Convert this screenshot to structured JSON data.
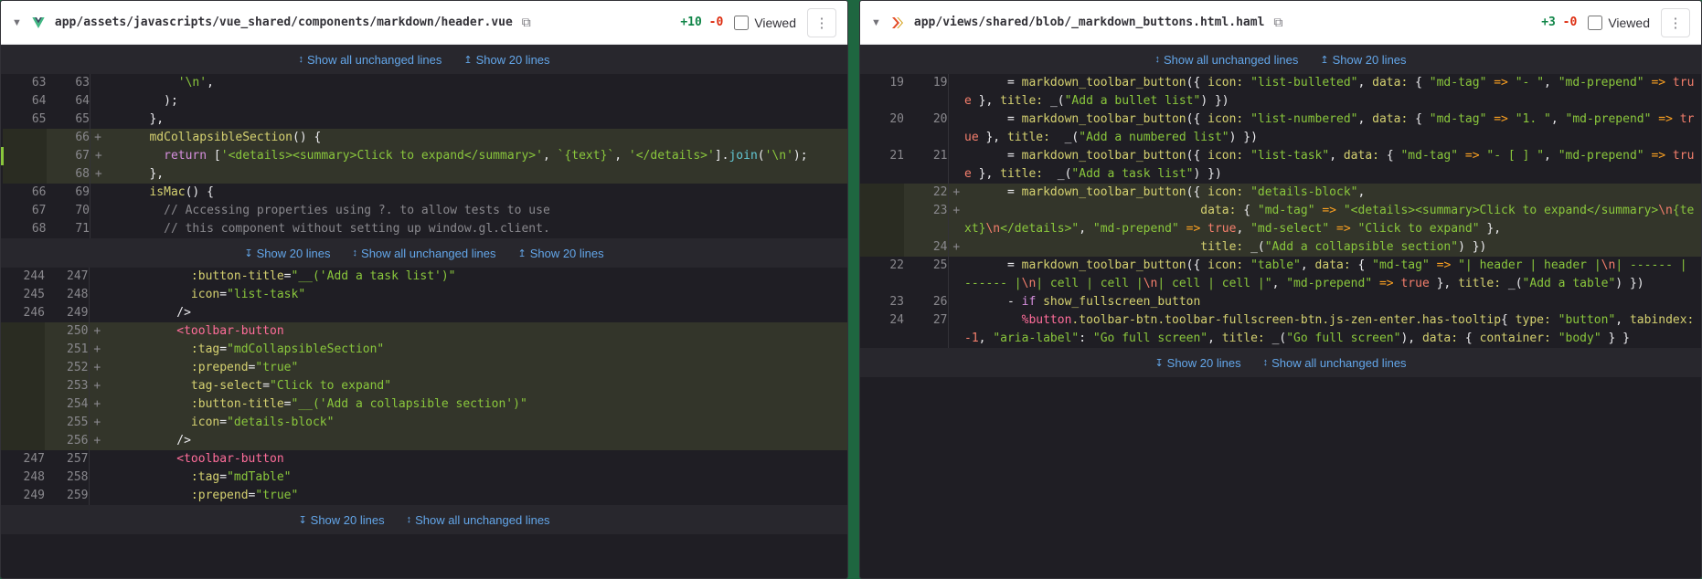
{
  "panels": [
    {
      "icon": "vue",
      "path": "app/assets/javascripts/vue_shared/components/markdown/header.vue",
      "added": "+10",
      "removed": "-0",
      "viewed_label": "Viewed",
      "expand_top": [
        "Show all unchanged lines",
        "Show 20 lines"
      ],
      "rows1": [
        {
          "o": "63",
          "n": "63",
          "t": "ctx",
          "sign": "",
          "html": "          <span class='c-str'>'\\n'</span><span class='c-punc'>,</span>"
        },
        {
          "o": "64",
          "n": "64",
          "t": "ctx",
          "sign": "",
          "html": "        <span class='c-punc'>);</span>"
        },
        {
          "o": "65",
          "n": "65",
          "t": "ctx",
          "sign": "",
          "html": "      <span class='c-punc'>},</span>"
        },
        {
          "o": "",
          "n": "66",
          "t": "added",
          "sign": "+",
          "html": "      <span class='c-attr'>mdCollapsibleSection</span><span class='c-punc'>()</span> <span class='c-punc'>{</span>"
        },
        {
          "o": "",
          "n": "67",
          "t": "added-hl",
          "sign": "+",
          "html": "        <span class='c-kw'>return</span> <span class='c-punc'>[</span><span class='c-str'>'&lt;details&gt;&lt;summary&gt;Click to expand&lt;/summary&gt;'</span><span class='c-punc'>,</span> <span class='c-str'>`{text}`</span><span class='c-punc'>,</span> <span class='c-str'>'&lt;/details&gt;'</span><span class='c-punc'>].</span><span class='c-func'>join</span><span class='c-punc'>(</span><span class='c-str'>'\\n'</span><span class='c-punc'>);</span>"
        },
        {
          "o": "",
          "n": "68",
          "t": "added",
          "sign": "+",
          "html": "      <span class='c-punc'>},</span>"
        },
        {
          "o": "66",
          "n": "69",
          "t": "ctx",
          "sign": "",
          "html": "      <span class='c-attr'>isMac</span><span class='c-punc'>()</span> <span class='c-punc'>{</span>"
        },
        {
          "o": "67",
          "n": "70",
          "t": "ctx",
          "sign": "",
          "html": "        <span class='c-comment'>// Accessing properties using ?. to allow tests to use</span>"
        },
        {
          "o": "68",
          "n": "71",
          "t": "ctx",
          "sign": "",
          "html": "        <span class='c-comment'>// this component without setting up window.gl.client.</span>"
        }
      ],
      "expand_mid": [
        "Show 20 lines",
        "Show all unchanged lines",
        "Show 20 lines"
      ],
      "rows2": [
        {
          "o": "244",
          "n": "247",
          "t": "ctx",
          "sign": "",
          "html": "            <span class='c-attr'>:button-title</span>=<span class='c-str'>\"__('Add a task list')\"</span>"
        },
        {
          "o": "245",
          "n": "248",
          "t": "ctx",
          "sign": "",
          "html": "            <span class='c-attr'>icon</span>=<span class='c-str'>\"list-task\"</span>"
        },
        {
          "o": "246",
          "n": "249",
          "t": "ctx",
          "sign": "",
          "html": "          <span class='c-punc'>/&gt;</span>"
        },
        {
          "o": "",
          "n": "250",
          "t": "added",
          "sign": "+",
          "html": "          <span class='c-tag'>&lt;toolbar-button</span>"
        },
        {
          "o": "",
          "n": "251",
          "t": "added",
          "sign": "+",
          "html": "            <span class='c-attr'>:tag</span>=<span class='c-str'>\"mdCollapsibleSection\"</span>"
        },
        {
          "o": "",
          "n": "252",
          "t": "added",
          "sign": "+",
          "html": "            <span class='c-attr'>:prepend</span>=<span class='c-str'>\"true\"</span>"
        },
        {
          "o": "",
          "n": "253",
          "t": "added",
          "sign": "+",
          "html": "            <span class='c-attr'>tag-select</span>=<span class='c-str'>\"Click to expand\"</span>"
        },
        {
          "o": "",
          "n": "254",
          "t": "added",
          "sign": "+",
          "html": "            <span class='c-attr'>:button-title</span>=<span class='c-str'>\"__('Add a collapsible section')\"</span>"
        },
        {
          "o": "",
          "n": "255",
          "t": "added",
          "sign": "+",
          "html": "            <span class='c-attr'>icon</span>=<span class='c-str'>\"details-block\"</span>"
        },
        {
          "o": "",
          "n": "256",
          "t": "added",
          "sign": "+",
          "html": "          <span class='c-punc'>/&gt;</span>"
        },
        {
          "o": "247",
          "n": "257",
          "t": "ctx",
          "sign": "",
          "html": "          <span class='c-tag'>&lt;toolbar-button</span>"
        },
        {
          "o": "248",
          "n": "258",
          "t": "ctx",
          "sign": "",
          "html": "            <span class='c-attr'>:tag</span>=<span class='c-str'>\"mdTable\"</span>"
        },
        {
          "o": "249",
          "n": "259",
          "t": "ctx",
          "sign": "",
          "html": "            <span class='c-attr'>:prepend</span>=<span class='c-str'>\"true\"</span>"
        }
      ],
      "expand_bot": [
        "Show 20 lines",
        "Show all unchanged lines"
      ]
    },
    {
      "icon": "haml",
      "path": "app/views/shared/blob/_markdown_buttons.html.haml",
      "added": "+3",
      "removed": "-0",
      "viewed_label": "Viewed",
      "expand_top": [
        "Show all unchanged lines",
        "Show 20 lines"
      ],
      "rows1": [
        {
          "o": "19",
          "n": "19",
          "t": "ctx",
          "sign": "",
          "html": "      <span class='c-punc'>=</span> <span class='c-key'>markdown_toolbar_button</span><span class='c-punc'>({</span> <span class='c-attr'>icon:</span> <span class='c-str'>\"list-bulleted\"</span><span class='c-punc'>,</span> <span class='c-attr'>data:</span> <span class='c-punc'>{</span> <span class='c-str'>\"md-tag\"</span> <span class='c-op'>=&gt;</span> <span class='c-str'>\"- \"</span><span class='c-punc'>,</span> <span class='c-str'>\"md-prepend\"</span> <span class='c-op'>=&gt;</span> <span class='c-bool'>true</span> <span class='c-punc'>},</span> <span class='c-attr'>title:</span> <span class='c-punc'>_(</span><span class='c-str'>\"Add a bullet list\"</span><span class='c-punc'>) })</span>"
        },
        {
          "o": "20",
          "n": "20",
          "t": "ctx",
          "sign": "",
          "html": "      <span class='c-punc'>=</span> <span class='c-key'>markdown_toolbar_button</span><span class='c-punc'>({</span> <span class='c-attr'>icon:</span> <span class='c-str'>\"list-numbered\"</span><span class='c-punc'>,</span> <span class='c-attr'>data:</span> <span class='c-punc'>{</span> <span class='c-str'>\"md-tag\"</span> <span class='c-op'>=&gt;</span> <span class='c-str'>\"1. \"</span><span class='c-punc'>,</span> <span class='c-str'>\"md-prepend\"</span> <span class='c-op'>=&gt;</span> <span class='c-bool'>true</span> <span class='c-punc'>},</span> <span class='c-attr'>title:</span>  <span class='c-punc'>_(</span><span class='c-str'>\"Add a numbered list\"</span><span class='c-punc'>) })</span>"
        },
        {
          "o": "21",
          "n": "21",
          "t": "ctx",
          "sign": "",
          "html": "      <span class='c-punc'>=</span> <span class='c-key'>markdown_toolbar_button</span><span class='c-punc'>({</span> <span class='c-attr'>icon:</span> <span class='c-str'>\"list-task\"</span><span class='c-punc'>,</span> <span class='c-attr'>data:</span> <span class='c-punc'>{</span> <span class='c-str'>\"md-tag\"</span> <span class='c-op'>=&gt;</span> <span class='c-str'>\"- [ ] \"</span><span class='c-punc'>,</span> <span class='c-str'>\"md-prepend\"</span> <span class='c-op'>=&gt;</span> <span class='c-bool'>true</span> <span class='c-punc'>},</span> <span class='c-attr'>title:</span>  <span class='c-punc'>_(</span><span class='c-str'>\"Add a task list\"</span><span class='c-punc'>) })</span>"
        },
        {
          "o": "",
          "n": "22",
          "t": "added",
          "sign": "+",
          "html": "      <span class='c-punc'>=</span> <span class='c-key'>markdown_toolbar_button</span><span class='c-punc'>({</span> <span class='c-attr'>icon:</span> <span class='c-str'>\"details-block\"</span><span class='c-punc'>,</span>"
        },
        {
          "o": "",
          "n": "23",
          "t": "added",
          "sign": "+",
          "html": "                                 <span class='c-attr'>data:</span> <span class='c-punc'>{</span> <span class='c-str'>\"md-tag\"</span> <span class='c-op'>=&gt;</span> <span class='c-str'>\"&lt;details&gt;&lt;summary&gt;Click to expand&lt;/summary&gt;</span><span class='c-bool'>\\n</span><span class='c-str'>{text}</span><span class='c-bool'>\\n</span><span class='c-str'>&lt;/details&gt;\"</span><span class='c-punc'>,</span> <span class='c-str'>\"md-prepend\"</span> <span class='c-op'>=&gt;</span> <span class='c-bool'>true</span><span class='c-punc'>,</span> <span class='c-str'>\"md-select\"</span> <span class='c-op'>=&gt;</span> <span class='c-str'>\"Click to expand\"</span> <span class='c-punc'>},</span>"
        },
        {
          "o": "",
          "n": "24",
          "t": "added",
          "sign": "+",
          "html": "                                 <span class='c-attr'>title:</span> <span class='c-punc'>_(</span><span class='c-str'>\"Add a collapsible section\"</span><span class='c-punc'>) })</span>"
        },
        {
          "o": "22",
          "n": "25",
          "t": "ctx",
          "sign": "",
          "html": "      <span class='c-punc'>=</span> <span class='c-key'>markdown_toolbar_button</span><span class='c-punc'>({</span> <span class='c-attr'>icon:</span> <span class='c-str'>\"table\"</span><span class='c-punc'>,</span> <span class='c-attr'>data:</span> <span class='c-punc'>{</span> <span class='c-str'>\"md-tag\"</span> <span class='c-op'>=&gt;</span> <span class='c-str'>\"| header | header |</span><span class='c-bool'>\\n</span><span class='c-str'>| ------ | ------ |</span><span class='c-bool'>\\n</span><span class='c-str'>| cell | cell |</span><span class='c-bool'>\\n</span><span class='c-str'>| cell | cell |\"</span><span class='c-punc'>,</span> <span class='c-str'>\"md-prepend\"</span> <span class='c-op'>=&gt;</span> <span class='c-bool'>true</span> <span class='c-punc'>},</span> <span class='c-attr'>title:</span> <span class='c-punc'>_(</span><span class='c-str'>\"Add a table\"</span><span class='c-punc'>) })</span>"
        },
        {
          "o": "23",
          "n": "26",
          "t": "ctx",
          "sign": "",
          "html": "      <span class='c-punc'>-</span> <span class='c-kw'>if</span> <span class='c-key'>show_fullscreen_button</span>"
        },
        {
          "o": "24",
          "n": "27",
          "t": "ctx",
          "sign": "",
          "html": "        <span class='c-tag'>%button</span><span class='c-key'>.toolbar-btn.toolbar-fullscreen-btn.js-zen-enter.has-tooltip</span><span class='c-punc'>{</span> <span class='c-attr'>type:</span> <span class='c-str'>\"button\"</span><span class='c-punc'>,</span> <span class='c-attr'>tabindex:</span> <span class='c-bool'>-1</span><span class='c-punc'>,</span> <span class='c-str'>\"aria-label\"</span><span class='c-punc'>:</span> <span class='c-str'>\"Go full screen\"</span><span class='c-punc'>,</span> <span class='c-attr'>title:</span> <span class='c-punc'>_(</span><span class='c-str'>\"Go full screen\"</span><span class='c-punc'>),</span> <span class='c-attr'>data:</span> <span class='c-punc'>{</span> <span class='c-attr'>container:</span> <span class='c-str'>\"body\"</span> <span class='c-punc'>} }</span>"
        }
      ],
      "expand_bot": [
        "Show 20 lines",
        "Show all unchanged lines"
      ]
    }
  ]
}
